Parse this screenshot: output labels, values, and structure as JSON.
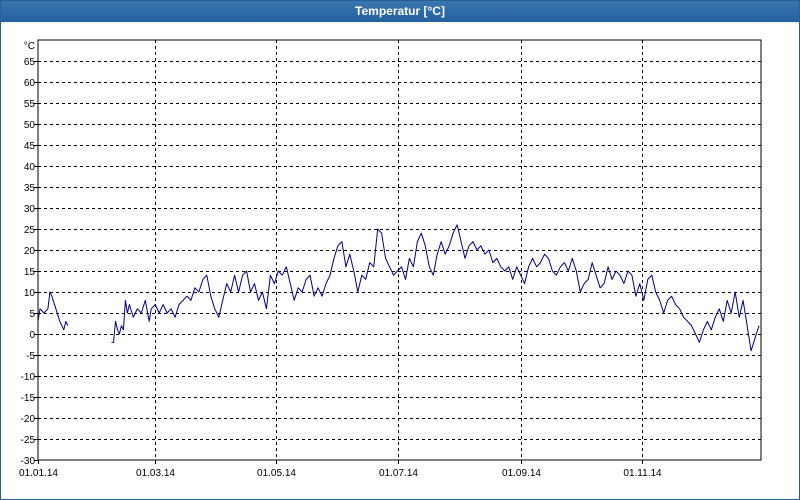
{
  "window": {
    "title": "Temperatur [°C]"
  },
  "chart_data": {
    "type": "line",
    "title": "Temperatur [°C]",
    "xlabel": "",
    "ylabel": "°C",
    "ylim": [
      -30,
      70
    ],
    "yticks": [
      -30,
      -25,
      -20,
      -15,
      -10,
      -5,
      0,
      5,
      10,
      15,
      20,
      25,
      30,
      35,
      40,
      45,
      50,
      55,
      60,
      65
    ],
    "xlim": [
      "2014-01-01",
      "2014-12-31"
    ],
    "x_tick_labels": [
      {
        "label": "01.01.14",
        "date": "2014-01-01"
      },
      {
        "label": "01.03.14",
        "date": "2014-03-01"
      },
      {
        "label": "01.05.14",
        "date": "2014-05-01"
      },
      {
        "label": "01.07.14",
        "date": "2014-07-01"
      },
      {
        "label": "01.09.14",
        "date": "2014-09-01"
      },
      {
        "label": "01.11.14",
        "date": "2014-11-01"
      }
    ],
    "grid": true,
    "line_color": "#00008b",
    "series": [
      {
        "points": [
          [
            "2014-01-01",
            3
          ],
          [
            "2014-01-02",
            6
          ],
          [
            "2014-01-04",
            5
          ],
          [
            "2014-01-06",
            6
          ],
          [
            "2014-01-07",
            10
          ],
          [
            "2014-01-08",
            9
          ],
          [
            "2014-01-10",
            6
          ],
          [
            "2014-01-12",
            3
          ],
          [
            "2014-01-14",
            1
          ],
          [
            "2014-01-15",
            3
          ],
          [
            "2014-01-16",
            2
          ],
          [
            null,
            null
          ],
          [
            "2014-02-07",
            -2
          ],
          [
            "2014-02-08",
            -2
          ],
          [
            "2014-02-09",
            3
          ],
          [
            "2014-02-10",
            1
          ],
          [
            "2014-02-11",
            0
          ],
          [
            "2014-02-12",
            2
          ],
          [
            "2014-02-13",
            1
          ],
          [
            "2014-02-14",
            8
          ],
          [
            "2014-02-15",
            5
          ],
          [
            "2014-02-16",
            7
          ],
          [
            "2014-02-18",
            4
          ],
          [
            "2014-02-20",
            6
          ],
          [
            "2014-02-22",
            5
          ],
          [
            "2014-02-24",
            8
          ],
          [
            "2014-02-26",
            3
          ],
          [
            "2014-02-27",
            6
          ],
          [
            "2014-03-01",
            7
          ],
          [
            "2014-03-03",
            5
          ],
          [
            "2014-03-05",
            7
          ],
          [
            "2014-03-07",
            5
          ],
          [
            "2014-03-09",
            6
          ],
          [
            "2014-03-11",
            4
          ],
          [
            "2014-03-13",
            7
          ],
          [
            "2014-03-15",
            8
          ],
          [
            "2014-03-17",
            9
          ],
          [
            "2014-03-19",
            8
          ],
          [
            "2014-03-21",
            11
          ],
          [
            "2014-03-23",
            10
          ],
          [
            "2014-03-25",
            13
          ],
          [
            "2014-03-27",
            14
          ],
          [
            "2014-03-29",
            9
          ],
          [
            "2014-03-31",
            6
          ],
          [
            "2014-04-02",
            4
          ],
          [
            "2014-04-04",
            8
          ],
          [
            "2014-04-06",
            12
          ],
          [
            "2014-04-08",
            10
          ],
          [
            "2014-04-10",
            14
          ],
          [
            "2014-04-12",
            10
          ],
          [
            "2014-04-14",
            14
          ],
          [
            "2014-04-16",
            15
          ],
          [
            "2014-04-18",
            10
          ],
          [
            "2014-04-20",
            12
          ],
          [
            "2014-04-22",
            8
          ],
          [
            "2014-04-24",
            10
          ],
          [
            "2014-04-26",
            6
          ],
          [
            "2014-04-28",
            14
          ],
          [
            "2014-04-30",
            12
          ],
          [
            "2014-05-02",
            15
          ],
          [
            "2014-05-04",
            14
          ],
          [
            "2014-05-06",
            16
          ],
          [
            "2014-05-08",
            12
          ],
          [
            "2014-05-10",
            8
          ],
          [
            "2014-05-12",
            11
          ],
          [
            "2014-05-14",
            10
          ],
          [
            "2014-05-16",
            13
          ],
          [
            "2014-05-18",
            14
          ],
          [
            "2014-05-20",
            9
          ],
          [
            "2014-05-22",
            11
          ],
          [
            "2014-05-24",
            9
          ],
          [
            "2014-05-26",
            12
          ],
          [
            "2014-05-28",
            14
          ],
          [
            "2014-05-30",
            18
          ],
          [
            "2014-06-01",
            21
          ],
          [
            "2014-06-03",
            22
          ],
          [
            "2014-06-05",
            16
          ],
          [
            "2014-06-07",
            19
          ],
          [
            "2014-06-09",
            15
          ],
          [
            "2014-06-11",
            10
          ],
          [
            "2014-06-13",
            14
          ],
          [
            "2014-06-15",
            13
          ],
          [
            "2014-06-17",
            17
          ],
          [
            "2014-06-19",
            16
          ],
          [
            "2014-06-21",
            25
          ],
          [
            "2014-06-23",
            24
          ],
          [
            "2014-06-25",
            18
          ],
          [
            "2014-06-27",
            16
          ],
          [
            "2014-06-29",
            14
          ],
          [
            "2014-07-01",
            15
          ],
          [
            "2014-07-03",
            16
          ],
          [
            "2014-07-05",
            13
          ],
          [
            "2014-07-07",
            18
          ],
          [
            "2014-07-09",
            16
          ],
          [
            "2014-07-11",
            22
          ],
          [
            "2014-07-13",
            24
          ],
          [
            "2014-07-15",
            21
          ],
          [
            "2014-07-17",
            16
          ],
          [
            "2014-07-19",
            14
          ],
          [
            "2014-07-21",
            19
          ],
          [
            "2014-07-23",
            22
          ],
          [
            "2014-07-25",
            19
          ],
          [
            "2014-07-27",
            21
          ],
          [
            "2014-07-29",
            24
          ],
          [
            "2014-07-31",
            26
          ],
          [
            "2014-08-02",
            22
          ],
          [
            "2014-08-04",
            18
          ],
          [
            "2014-08-06",
            21
          ],
          [
            "2014-08-08",
            22
          ],
          [
            "2014-08-10",
            20
          ],
          [
            "2014-08-12",
            21
          ],
          [
            "2014-08-14",
            19
          ],
          [
            "2014-08-16",
            20
          ],
          [
            "2014-08-18",
            17
          ],
          [
            "2014-08-20",
            18
          ],
          [
            "2014-08-22",
            16
          ],
          [
            "2014-08-24",
            15
          ],
          [
            "2014-08-26",
            16
          ],
          [
            "2014-08-28",
            13
          ],
          [
            "2014-08-30",
            16
          ],
          [
            "2014-09-01",
            14
          ],
          [
            "2014-09-03",
            12
          ],
          [
            "2014-09-05",
            16
          ],
          [
            "2014-09-07",
            18
          ],
          [
            "2014-09-09",
            16
          ],
          [
            "2014-09-11",
            17
          ],
          [
            "2014-09-13",
            19
          ],
          [
            "2014-09-15",
            18
          ],
          [
            "2014-09-17",
            15
          ],
          [
            "2014-09-19",
            14
          ],
          [
            "2014-09-21",
            16
          ],
          [
            "2014-09-23",
            17
          ],
          [
            "2014-09-25",
            15
          ],
          [
            "2014-09-27",
            18
          ],
          [
            "2014-09-29",
            15
          ],
          [
            "2014-10-01",
            10
          ],
          [
            "2014-10-03",
            12
          ],
          [
            "2014-10-05",
            13
          ],
          [
            "2014-10-07",
            17
          ],
          [
            "2014-10-09",
            14
          ],
          [
            "2014-10-11",
            11
          ],
          [
            "2014-10-13",
            12
          ],
          [
            "2014-10-15",
            16
          ],
          [
            "2014-10-17",
            13
          ],
          [
            "2014-10-19",
            15
          ],
          [
            "2014-10-21",
            14
          ],
          [
            "2014-10-23",
            12
          ],
          [
            "2014-10-25",
            15
          ],
          [
            "2014-10-27",
            14
          ],
          [
            "2014-10-29",
            9
          ],
          [
            "2014-10-31",
            12
          ],
          [
            "2014-11-02",
            8
          ],
          [
            "2014-11-04",
            13
          ],
          [
            "2014-11-06",
            14
          ],
          [
            "2014-11-08",
            10
          ],
          [
            "2014-11-10",
            8
          ],
          [
            "2014-11-12",
            5
          ],
          [
            "2014-11-14",
            8
          ],
          [
            "2014-11-16",
            9
          ],
          [
            "2014-11-18",
            7
          ],
          [
            "2014-11-20",
            6
          ],
          [
            "2014-11-22",
            4
          ],
          [
            "2014-11-24",
            3
          ],
          [
            "2014-11-26",
            2
          ],
          [
            "2014-11-28",
            0
          ],
          [
            "2014-11-30",
            -2
          ],
          [
            "2014-12-02",
            1
          ],
          [
            "2014-12-04",
            3
          ],
          [
            "2014-12-06",
            1
          ],
          [
            "2014-12-08",
            4
          ],
          [
            "2014-12-10",
            6
          ],
          [
            "2014-12-12",
            3
          ],
          [
            "2014-12-14",
            8
          ],
          [
            "2014-12-16",
            5
          ],
          [
            "2014-12-18",
            10
          ],
          [
            "2014-12-20",
            4
          ],
          [
            "2014-12-22",
            8
          ],
          [
            "2014-12-24",
            2
          ],
          [
            "2014-12-26",
            -4
          ],
          [
            "2014-12-28",
            -1
          ],
          [
            "2014-12-30",
            2
          ]
        ]
      }
    ]
  }
}
